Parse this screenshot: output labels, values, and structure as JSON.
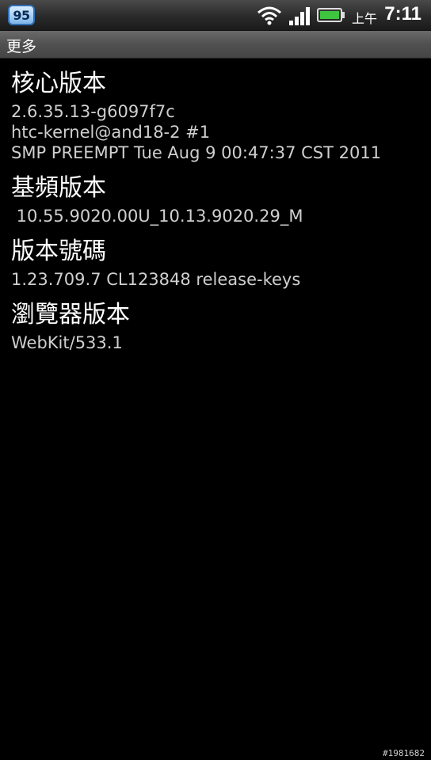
{
  "status_bar": {
    "notification_count": "95",
    "icons": [
      "wifi-icon",
      "signal-icon",
      "battery-icon"
    ],
    "ampm": "上午",
    "time": "7:11"
  },
  "title_bar": {
    "title": "更多"
  },
  "items": [
    {
      "title": "核心版本",
      "lines": [
        "2.6.35.13-g6097f7c",
        "htc-kernel@and18-2 #1",
        "SMP PREEMPT Tue Aug 9 00:47:37 CST 2011"
      ]
    },
    {
      "title": "基頻版本",
      "lines": [
        " 10.55.9020.00U_10.13.9020.29_M"
      ]
    },
    {
      "title": "版本號碼",
      "lines": [
        "1.23.709.7 CL123848 release-keys"
      ]
    },
    {
      "title": "瀏覽器版本",
      "lines": [
        "WebKit/533.1"
      ]
    }
  ],
  "watermark": "#1981682",
  "colors": {
    "background": "#000000",
    "title_text": "#ffffff",
    "value_text": "#cfcfcf",
    "battery_green": "#3ec43e"
  }
}
